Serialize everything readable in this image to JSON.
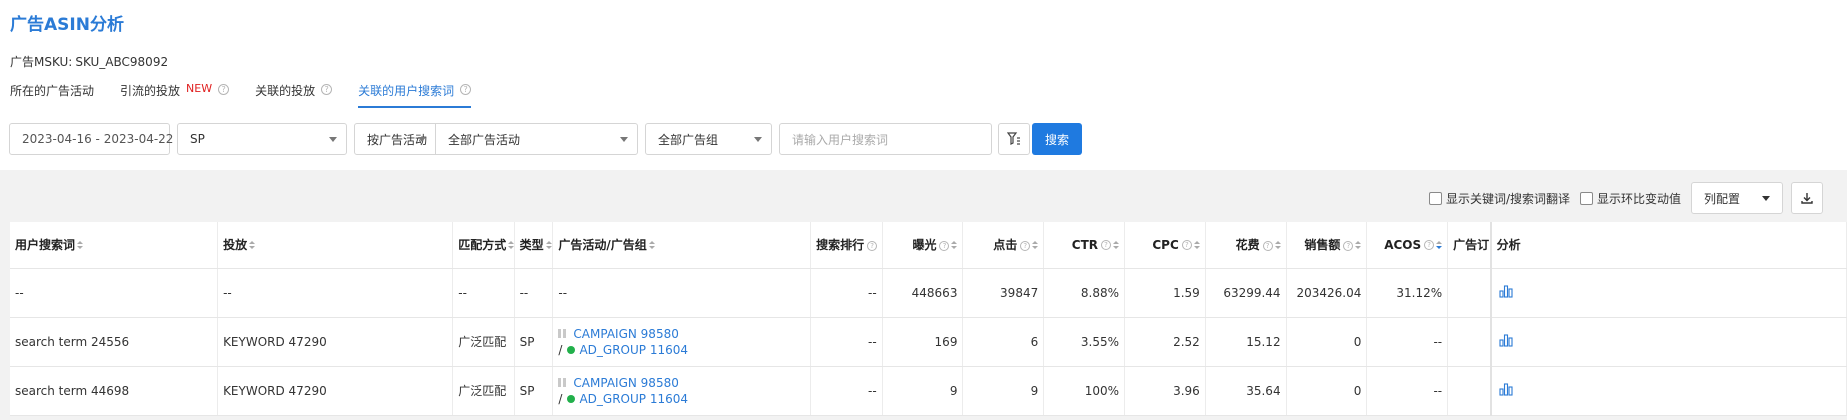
{
  "page_title": "广告ASIN分析",
  "msku": {
    "label": "广告MSKU:",
    "value": "SKU_ABC98092"
  },
  "tabs": [
    {
      "label": "所在的广告活动",
      "active": false
    },
    {
      "label": "引流的投放",
      "badge": "NEW",
      "help": true,
      "active": false
    },
    {
      "label": "关联的投放",
      "help": true,
      "active": false
    },
    {
      "label": "关联的用户搜索词",
      "help": true,
      "active": true
    }
  ],
  "filters": {
    "date_range": "2023-04-16 - 2023-04-22",
    "ad_type": "SP",
    "scope": "按广告活动",
    "campaign": "全部广告活动",
    "ad_group": "全部广告组",
    "search_placeholder": "请输入用户搜索词",
    "search_button": "搜索"
  },
  "toolbar": {
    "show_translation": "显示关键词/搜索词翻译",
    "show_change": "显示环比变动值",
    "column_config": "列配置"
  },
  "table": {
    "columns": {
      "search_term": "用户搜索词",
      "targeting": "投放",
      "match_type": "匹配方式",
      "type": "类型",
      "campaign_group": "广告活动/广告组",
      "search_rank": "搜索排行",
      "impressions": "曝光",
      "clicks": "点击",
      "ctr": "CTR",
      "cpc": "CPC",
      "spend": "花费",
      "sales": "销售额",
      "acos": "ACOS",
      "ad_orders": "广告订",
      "analysis": "分析"
    },
    "summary": {
      "search_term": "--",
      "targeting": "--",
      "match_type": "--",
      "type": "--",
      "campaign": "--",
      "search_rank": "--",
      "impressions": "448663",
      "clicks": "39847",
      "ctr": "8.88%",
      "cpc": "1.59",
      "spend": "63299.44",
      "sales": "203426.04",
      "acos": "31.12%",
      "ad_orders": ""
    },
    "rows": [
      {
        "search_term": "search term 24556",
        "targeting": "KEYWORD 47290",
        "match_type": "广泛匹配",
        "type": "SP",
        "campaign": "CAMPAIGN 98580",
        "ad_group": "AD_GROUP 11604",
        "group_prefix": "/",
        "search_rank": "--",
        "impressions": "169",
        "clicks": "6",
        "ctr": "3.55%",
        "cpc": "2.52",
        "spend": "15.12",
        "sales": "0",
        "acos": "--",
        "ad_orders": ""
      },
      {
        "search_term": "search term 44698",
        "targeting": "KEYWORD 47290",
        "match_type": "广泛匹配",
        "type": "SP",
        "campaign": "CAMPAIGN 98580",
        "ad_group": "AD_GROUP 11604",
        "group_prefix": "/",
        "search_rank": "--",
        "impressions": "9",
        "clicks": "9",
        "ctr": "100%",
        "cpc": "3.96",
        "spend": "35.64",
        "sales": "0",
        "acos": "--",
        "ad_orders": ""
      }
    ]
  },
  "colors": {
    "accent": "#2b7bd6",
    "button": "#1f7ae0",
    "new_badge": "#e02020",
    "group_dot": "#22b04b"
  }
}
